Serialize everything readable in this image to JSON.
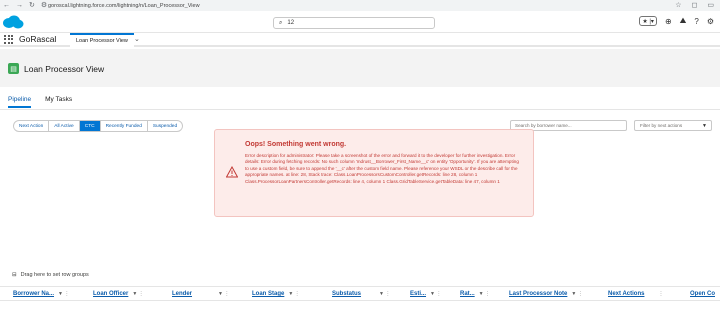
{
  "browser": {
    "url": "goroscal.lightning.force.com/lightning/n/Loan_Processor_View"
  },
  "header": {
    "search_value": "12",
    "fav_label": "★ |▾"
  },
  "app": {
    "name": "GoRascal",
    "tab_label": "Loan Processor View"
  },
  "page": {
    "title": "Loan Processor View"
  },
  "tabs": [
    {
      "label": "Pipeline"
    },
    {
      "label": "My Tasks"
    }
  ],
  "filters": [
    "Next Action",
    "All Active",
    "CTC",
    "Recently Funded",
    "Suspended"
  ],
  "search_borrower": {
    "placeholder": "Search by borrower name..."
  },
  "next_actions_filter": {
    "placeholder": "Filter by next actions"
  },
  "error": {
    "title": "Oops! Something went wrong.",
    "message": "Error description for administrator: Please take a screenshot of the error and forward it to the developer for further investigation. Error details: Error during fetching records: No such column 'mdrust__Borrower_First_Name__c' on entity 'Opportunity'. If you are attempting to use a custom field, be sure to append the '__c' after the custom field name. Please reference your WSDL or the describe call for the appropriate names. at line: 28, Stack trace: Class.LoanProcessorsCustomController.getRecords: line 28, column 1 Class.ProcessorLoanPartnersController.getRecords: line 4, column 1 Class.GridTableService.getTableData: line 47, column 1"
  },
  "row_group_label": "Drag here to set row groups",
  "columns": [
    "Borrower Na...",
    "Loan Officer",
    "Lender",
    "Loan Stage",
    "Substatus",
    "Esti...",
    "Rat...",
    "Last Processor Note",
    "Next Actions",
    "Open Co"
  ],
  "colors": {
    "brand": "#0176d3",
    "error": "#c23934",
    "error_bg": "#fdecea",
    "app_icon": "#3ba755"
  }
}
